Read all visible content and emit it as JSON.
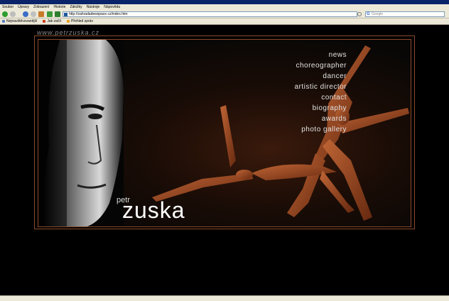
{
  "browser": {
    "menu": [
      "Soubor",
      "Úpravy",
      "Zobrazení",
      "Historie",
      "Záložky",
      "Nástroje",
      "Nápověda"
    ],
    "url": "http://zahradadewspace.cz/index.htm",
    "search_placeholder": "Google",
    "bookmarks": [
      "Nejnavštěvovanější",
      "Jak začít",
      "Přehled zpráv"
    ]
  },
  "site": {
    "url_text": "www.petrzuska.cz",
    "name_first": "petr",
    "name_last": "zuska",
    "nav": [
      "news",
      "choreographer",
      "dancer",
      "artistic director",
      "contact",
      "biography",
      "awards",
      "photo gallery"
    ]
  },
  "colors": {
    "frame_border": "#8a4a2a",
    "nav_text": "#e2e2e2",
    "background": "#000000"
  },
  "icons": [
    "back-icon",
    "forward-icon",
    "reload-icon",
    "stop-icon",
    "home-icon",
    "go-icon",
    "google-search-icon"
  ]
}
